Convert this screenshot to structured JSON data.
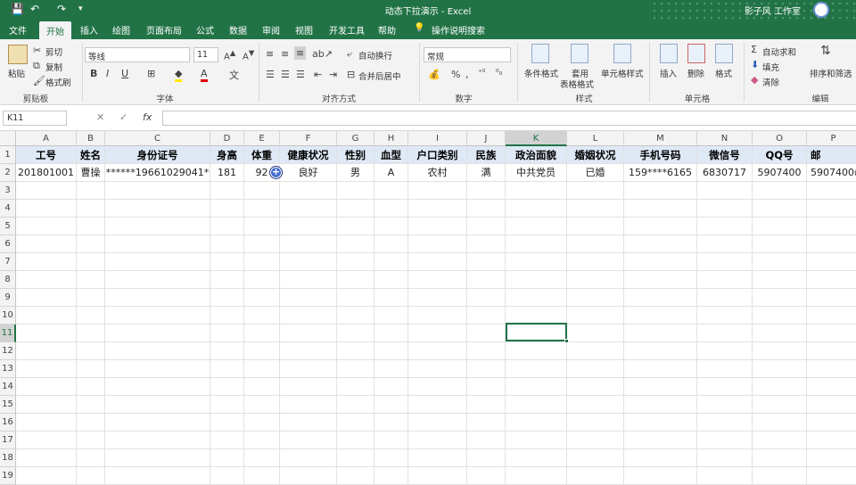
{
  "title": {
    "text": "动态下拉演示 - Excel",
    "user": "影子风 工作室"
  },
  "quick_access": {
    "save_icon": "save-icon",
    "undo_icon": "undo-icon",
    "redo_icon": "redo-icon"
  },
  "tabs": [
    "文件",
    "开始",
    "插入",
    "绘图",
    "页面布局",
    "公式",
    "数据",
    "审阅",
    "视图",
    "开发工具",
    "帮助"
  ],
  "tell_me": "操作说明搜索",
  "ribbon": {
    "clipboard": {
      "paste": "粘贴",
      "cut": "剪切",
      "copy": "复制",
      "format_painter": "格式刷",
      "group": "剪贴板"
    },
    "font": {
      "name": "等线",
      "size": "11",
      "bold": "B",
      "italic": "I",
      "underline": "U",
      "group": "字体"
    },
    "alignment": {
      "wrap": "自动换行",
      "merge": "合并后居中",
      "group": "对齐方式"
    },
    "number": {
      "format": "常规",
      "group": "数字"
    },
    "styles": {
      "conditional": "条件格式",
      "table_line1": "套用",
      "table_line2": "表格格式",
      "cell_styles": "单元格样式",
      "group": "样式"
    },
    "cells": {
      "insert": "插入",
      "delete": "删除",
      "format": "格式",
      "group": "单元格"
    },
    "editing": {
      "autosum": "自动求和",
      "fill": "填充",
      "clear": "清除",
      "sort": "排序和筛选",
      "group": "编辑"
    }
  },
  "namebox": "K11",
  "formula_icons": {
    "cancel": "✕",
    "enter": "✓",
    "fx": "fx"
  },
  "columns": [
    "A",
    "B",
    "C",
    "D",
    "E",
    "F",
    "G",
    "H",
    "I",
    "J",
    "K",
    "L",
    "M",
    "N",
    "O",
    "P"
  ],
  "headers": [
    "工号",
    "姓名",
    "身份证号",
    "身高",
    "体重",
    "健康状况",
    "性别",
    "血型",
    "户口类别",
    "民族",
    "政治面貌",
    "婚姻状况",
    "手机号码",
    "微信号",
    "QQ号",
    "邮"
  ],
  "row2": [
    "201801001",
    "曹操",
    "******19661029041*",
    "181",
    "92",
    "良好",
    "男",
    "A",
    "农村",
    "满",
    "中共党员",
    "已婚",
    "159****6165",
    "6830717",
    "5907400",
    "5907400@"
  ],
  "row_numbers": [
    "1",
    "2",
    "3",
    "4",
    "5",
    "6",
    "7",
    "8",
    "9",
    "10",
    "11",
    "12",
    "13",
    "14",
    "15",
    "16",
    "17",
    "18",
    "19"
  ],
  "selected_cell": "K11",
  "colors": {
    "accent": "#217346",
    "header_fill": "#dfe9f5"
  }
}
